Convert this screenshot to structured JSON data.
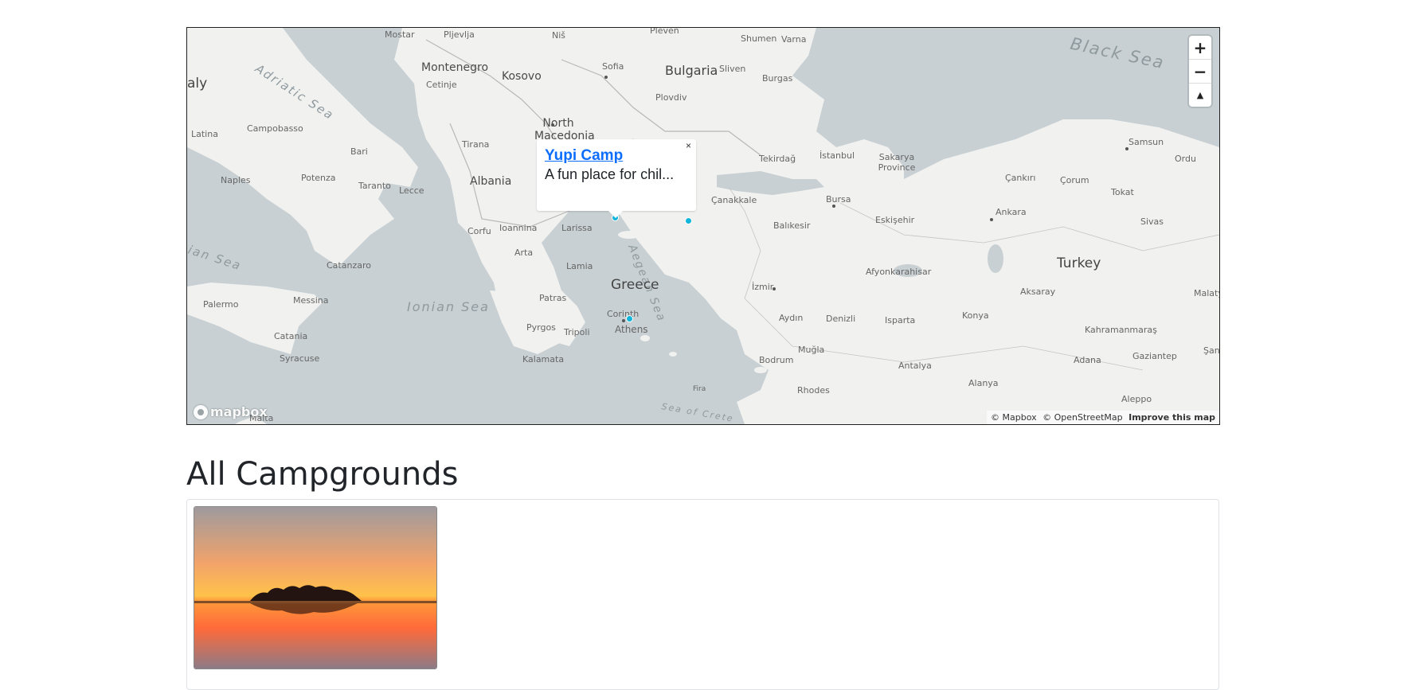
{
  "map": {
    "seas": [
      "Black Sea",
      "Adriatic Sea",
      "Ionian Sea",
      "Aegean Sea",
      "Sea of Crete",
      "ian Sea"
    ],
    "countries": [
      "Montenegro",
      "Kosovo",
      "Bulgaria",
      "North Macedonia",
      "Albania",
      "Greece",
      "Turkey",
      "aly"
    ],
    "cities": [
      "Mostar",
      "Pljevlja",
      "Niš",
      "Pleven",
      "Shumen",
      "Varna",
      "Sofia",
      "Sliven",
      "Burgas",
      "Cetinje",
      "Plovdiv",
      "Latina",
      "Campobasso",
      "Bari",
      "Tirana",
      "Naples",
      "Potenza",
      "Taranto",
      "Lecce",
      "Tekirdağ",
      "İstanbul",
      "Sakarya Province",
      "Samsun",
      "Ordu",
      "Çankırı",
      "Çorum",
      "Tokat",
      "Bursa",
      "Çanakkale",
      "Eskişehir",
      "Ankara",
      "Balıkesir",
      "Sivas",
      "Ioannina",
      "Larissa",
      "Corfu",
      "Arta",
      "Lamia",
      "Catanzaro",
      "Afyonkarahisar",
      "Patras",
      "Corinth",
      "İzmir",
      "Aksaray",
      "Malatya",
      "Palermo",
      "Messina",
      "Aydın",
      "Denizli",
      "Isparta",
      "Konya",
      "Pyrgos",
      "Tripoli",
      "Athens",
      "Kahramanmaraş",
      "Catania",
      "Syracuse",
      "Muğla",
      "Bodrum",
      "Adana",
      "Gaziantep",
      "Kalamata",
      "Antalya",
      "Alanya",
      "Şanlıurfa",
      "Rhodes",
      "Fira",
      "Aleppo",
      "Malta"
    ],
    "popup": {
      "title": "Yupi Camp",
      "description": "A fun place for chil...",
      "close": "×"
    },
    "controls": {
      "zoom_in": "+",
      "zoom_out": "−",
      "compass": "▲"
    },
    "logo": "mapbox",
    "attribution": {
      "mapbox": "© Mapbox",
      "osm": "© OpenStreetMap",
      "improve": "Improve this map"
    }
  },
  "page": {
    "heading": "All Campgrounds"
  }
}
